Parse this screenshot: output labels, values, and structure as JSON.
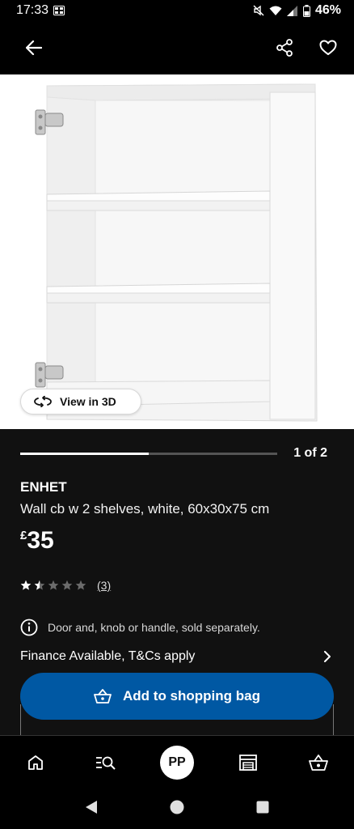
{
  "status_bar": {
    "time": "17:33",
    "battery": "46%"
  },
  "app_bar": {
    "back_icon": "back-arrow-icon",
    "share_icon": "share-icon",
    "favourite_icon": "heart-icon"
  },
  "gallery": {
    "view_3d_label": "View in 3D",
    "counter": "1 of 2",
    "progress": 0.5
  },
  "product": {
    "name": "ENHET",
    "description": "Wall cb w 2 shelves, white, 60x30x75 cm",
    "currency": "£",
    "price": "35",
    "rating": 1.5,
    "rating_max": 5,
    "review_count": "(3)",
    "notice": "Door and, knob or handle, sold separately.",
    "finance": "Finance Available, T&Cs apply"
  },
  "actions": {
    "add_to_bag": "Add to shopping bag"
  },
  "bottom_nav": {
    "avatar_initials": "PP"
  },
  "colors": {
    "accent": "#0058a3",
    "background": "#111111",
    "bar": "#000000"
  }
}
